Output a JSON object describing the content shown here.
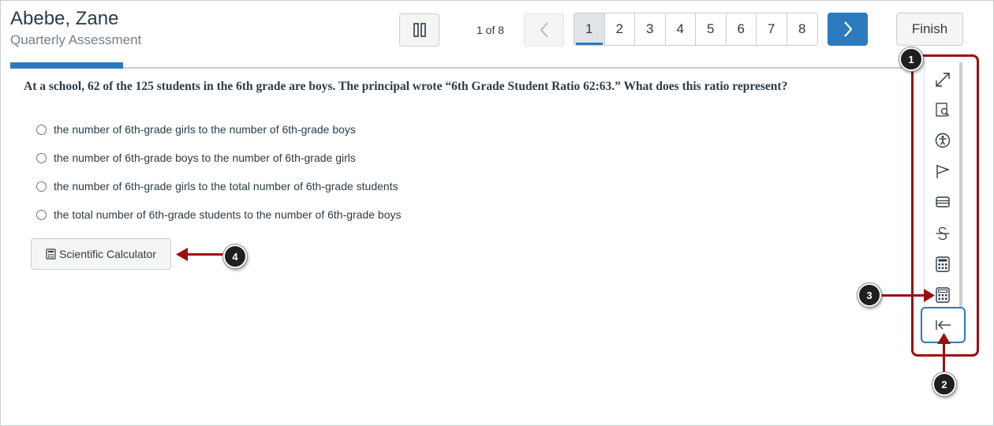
{
  "header": {
    "student_name": "Abebe, Zane",
    "assessment_title": "Quarterly Assessment",
    "counter": "1 of 8",
    "pages": [
      "1",
      "2",
      "3",
      "4",
      "5",
      "6",
      "7",
      "8"
    ],
    "current_page": "1",
    "finish_label": "Finish",
    "progress": 0.125
  },
  "question": {
    "text": "At a school, 62 of the 125 students in the 6th grade are boys. The principal wrote “6th Grade Student Ratio 62:63.” What does this ratio represent?",
    "options": [
      "the number of 6th-grade girls to the number of 6th-grade boys",
      "the number of 6th-grade boys to the number of 6th-grade girls",
      "the number of 6th-grade girls to the total number of 6th-grade students",
      "the total number of 6th-grade students to the number of 6th-grade boys"
    ]
  },
  "calculator": {
    "label": "Scientific Calculator"
  },
  "tools": [
    "expand-icon",
    "magnifier-icon",
    "accessibility-icon",
    "flag-icon",
    "line-reader-icon",
    "strikethrough-icon",
    "calculator-icon",
    "scientific-calculator-icon"
  ],
  "collapse_icon": "collapse-left-icon",
  "callouts": [
    "1",
    "2",
    "3",
    "4"
  ],
  "colors": {
    "accent": "#2b7abc",
    "callout_arrow": "#9b0e0e",
    "text": "#2d3b45"
  }
}
